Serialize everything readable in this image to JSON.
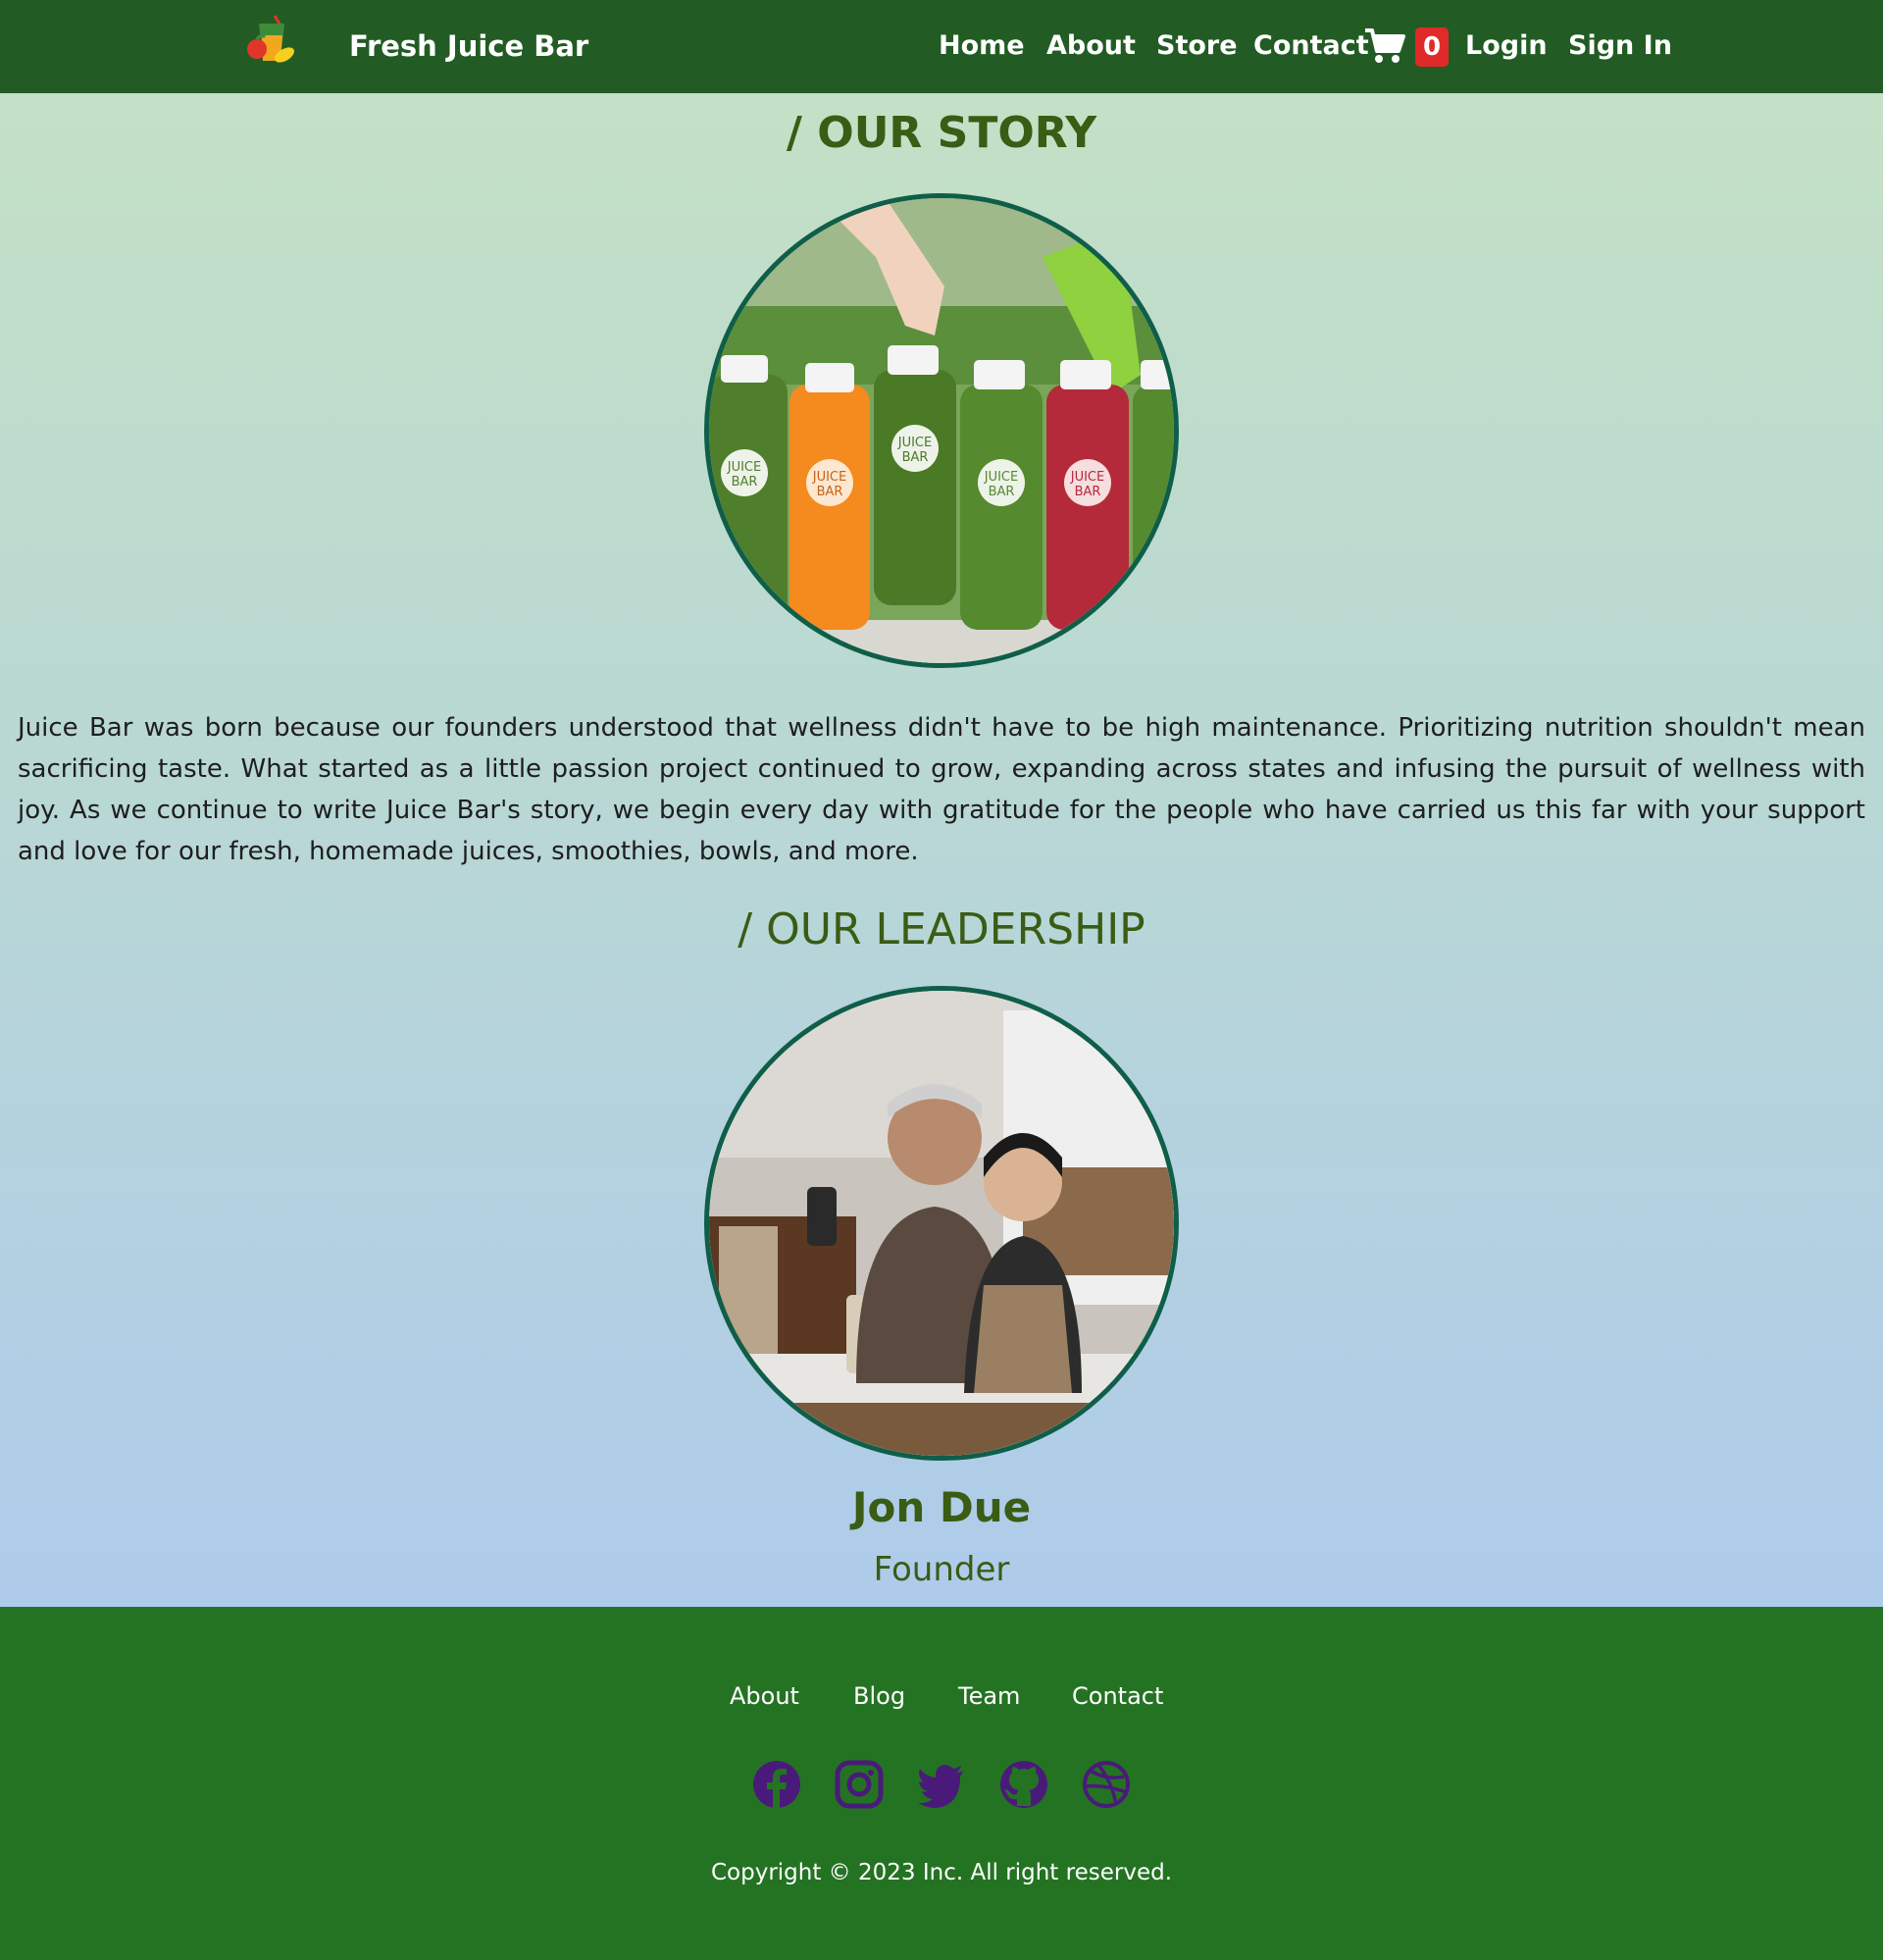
{
  "nav": {
    "brand": "Fresh Juice Bar",
    "links": [
      "Home",
      "About",
      "Store",
      "Contact"
    ],
    "cart_count": "0",
    "login": "Login",
    "signin": "Sign In"
  },
  "story": {
    "title": "/ OUR STORY",
    "image_alt": "Juice bottles",
    "bottle_labels": [
      "JUICE",
      "BAR"
    ],
    "text": "Juice Bar was born because our founders understood that wellness didn't have to be high maintenance. Prioritizing nutrition shouldn't mean sacrificing taste. What started as a little passion project continued to grow, expanding across states and infusing the pursuit of wellness with joy. As we continue to write Juice Bar's story, we begin every day with gratitude for the people who have carried us this far with your support and love for our fresh, homemade juices, smoothies, bowls, and more."
  },
  "leadership": {
    "title": "/ OUR LEADERSHIP",
    "name": "Jon Due",
    "role": "Founder"
  },
  "footer": {
    "links": [
      "About",
      "Blog",
      "Team",
      "Contact"
    ],
    "social_icons": [
      "facebook-icon",
      "instagram-icon",
      "twitter-icon",
      "github-icon",
      "dribbble-icon"
    ],
    "copyright": "Copyright © 2023 Inc. All right reserved."
  },
  "colors": {
    "nav_bg": "#225c24",
    "footer_bg": "#247323",
    "title": "#3a5c14",
    "circle_border": "#0f5e49",
    "cart_badge": "#e12a2a",
    "social_icon": "#4a1a7a"
  }
}
